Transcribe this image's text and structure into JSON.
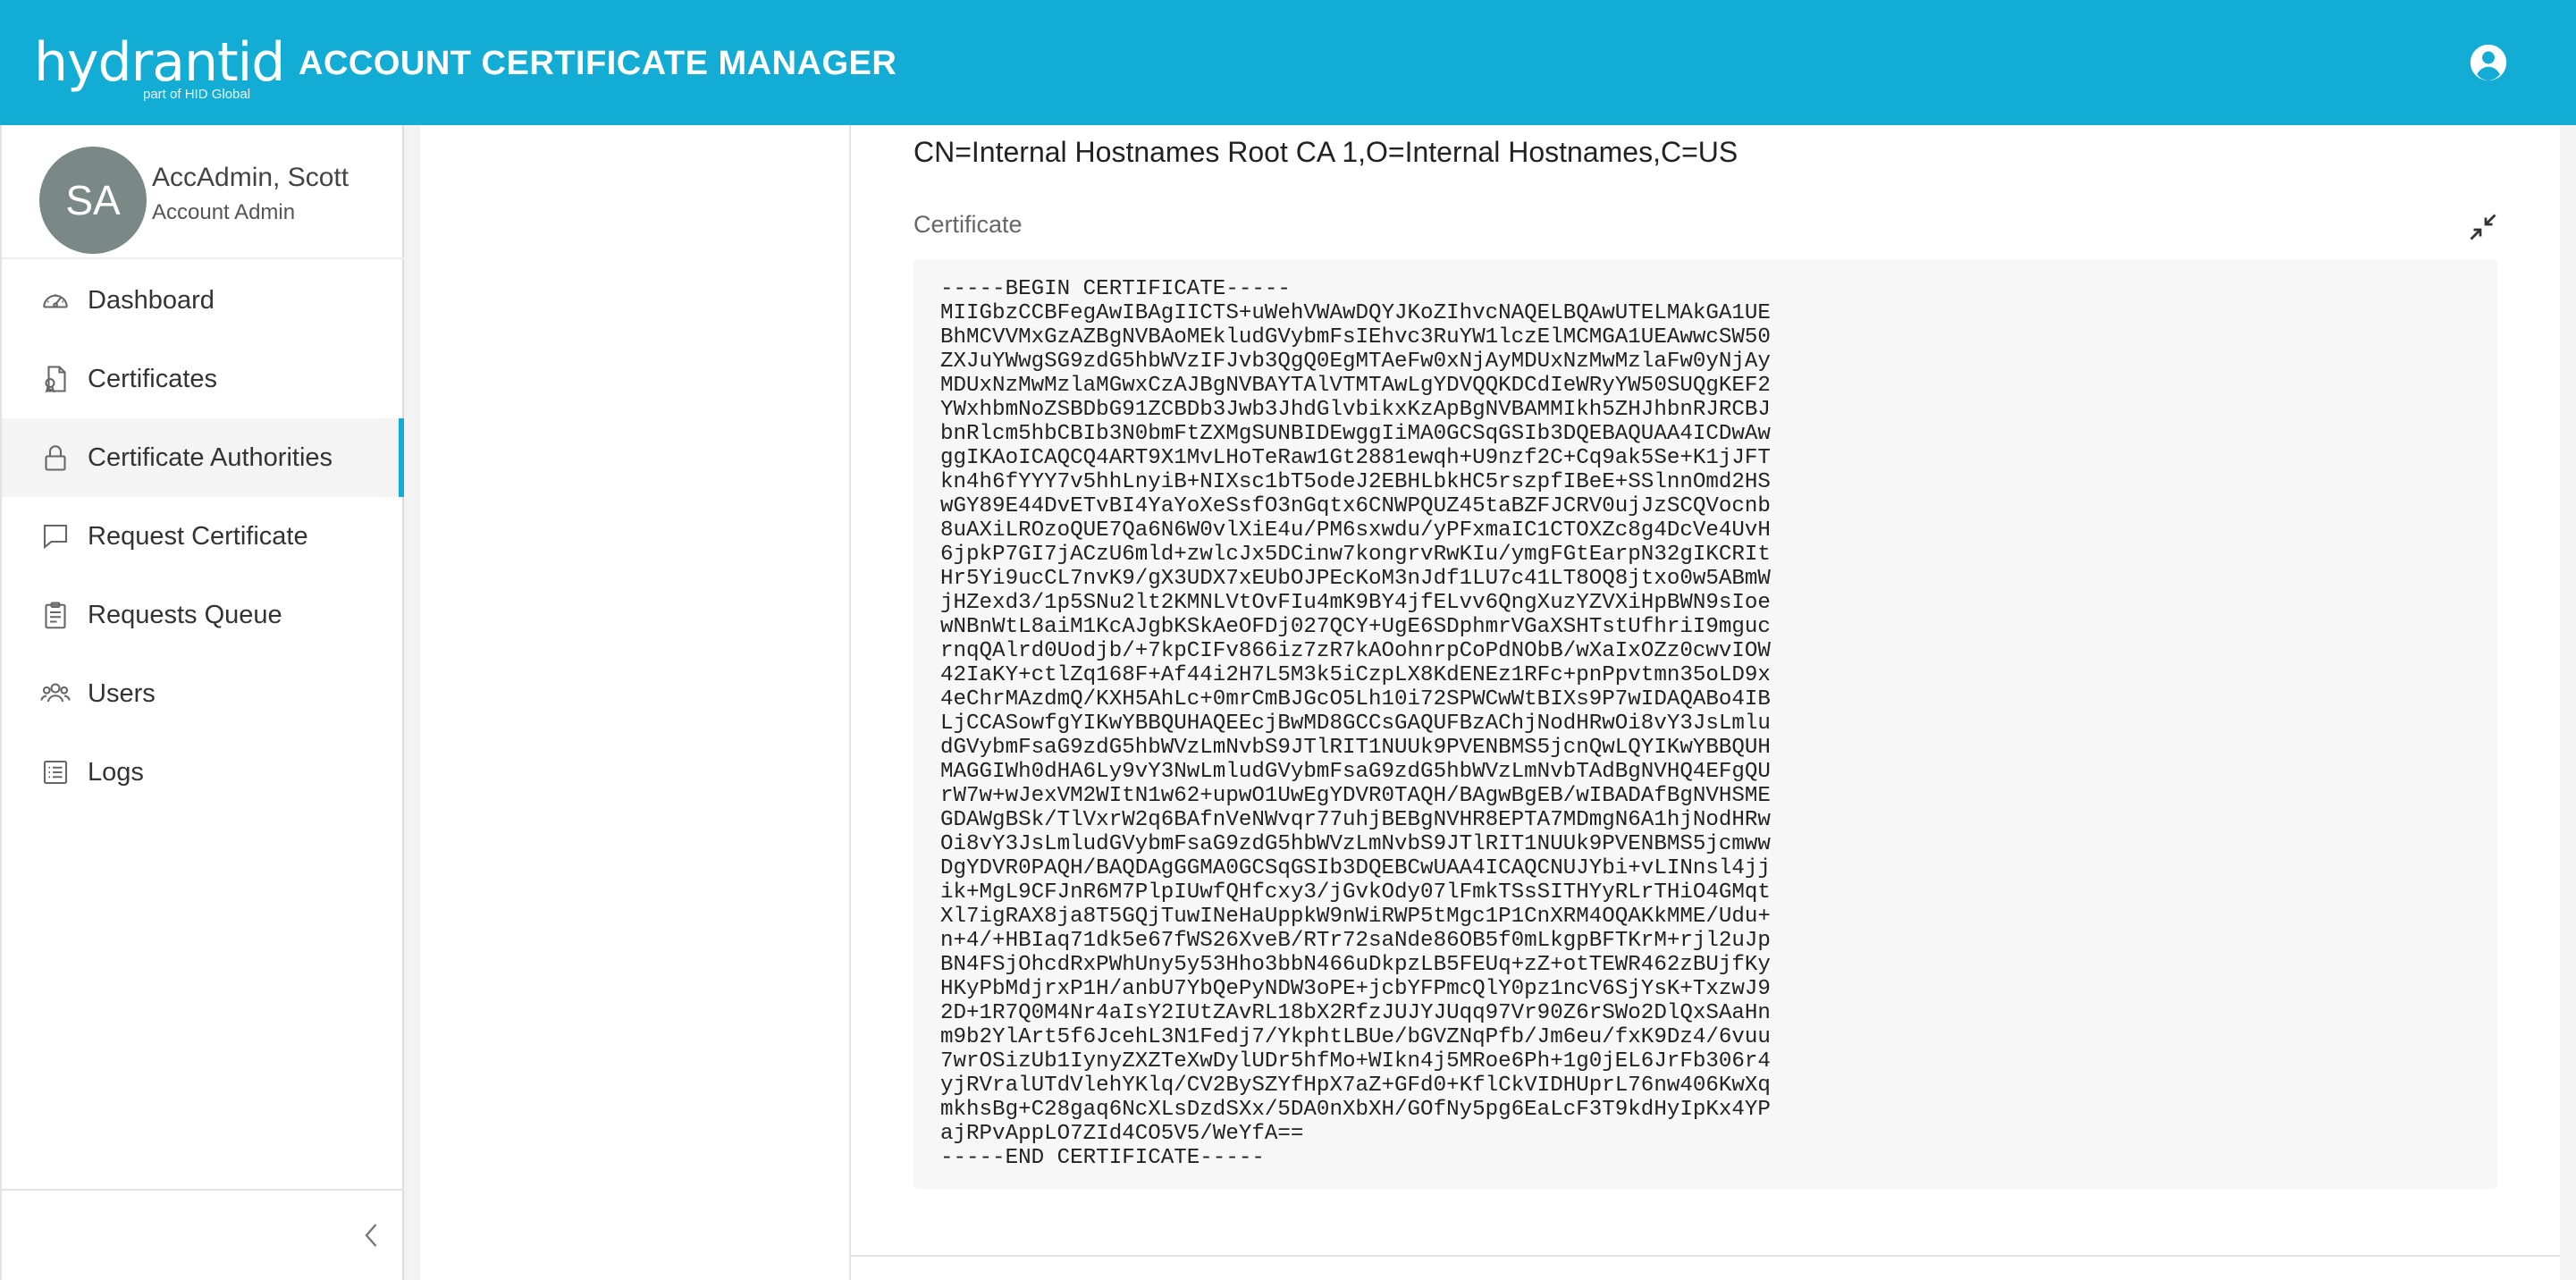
{
  "header": {
    "logo_text": "hydrantid",
    "logo_sub": "part of HID Global",
    "title": "ACCOUNT CERTIFICATE MANAGER",
    "account_icon": "account-circle-icon"
  },
  "sidebar": {
    "profile": {
      "initials": "SA",
      "name": "AccAdmin, Scott",
      "role": "Account Admin"
    },
    "items": [
      {
        "label": "Dashboard",
        "icon": "dashboard-gauge-icon",
        "active": false
      },
      {
        "label": "Certificates",
        "icon": "certificate-file-icon",
        "active": false
      },
      {
        "label": "Certificate Authorities",
        "icon": "lock-icon",
        "active": true
      },
      {
        "label": "Request Certificate",
        "icon": "chat-bubble-icon",
        "active": false
      },
      {
        "label": "Requests Queue",
        "icon": "clipboard-icon",
        "active": false
      },
      {
        "label": "Users",
        "icon": "users-icon",
        "active": false
      },
      {
        "label": "Logs",
        "icon": "list-icon",
        "active": false
      }
    ],
    "collapse_icon": "chevron-left-icon"
  },
  "main": {
    "issuer": "CN=Internal Hostnames Root CA 1,O=Internal Hostnames,C=US",
    "certificate_label": "Certificate",
    "collapse_icon": "collapse-arrows-icon",
    "certificate_pem": "-----BEGIN CERTIFICATE-----\nMIIGbzCCBFegAwIBAgIICTS+uWehVWAwDQYJKoZIhvcNAQELBQAwUTELMAkGA1UE\nBhMCVVMxGzAZBgNVBAoMEkludGVybmFsIEhvc3RuYW1lczElMCMGA1UEAwwcSW50\nZXJuYWwgSG9zdG5hbWVzIFJvb3QgQ0EgMTAeFw0xNjAyMDUxNzMwMzlaFw0yNjAy\nMDUxNzMwMzlaMGwxCzAJBgNVBAYTAlVTMTAwLgYDVQQKDCdIeWRyYW50SUQgKEF2\nYWxhbmNoZSBDbG91ZCBDb3Jwb3JhdGlvbikxKzApBgNVBAMMIkh5ZHJhbnRJRCBJ\nbnRlcm5hbCBIb3N0bmFtZXMgSUNBIDEwggIiMA0GCSqGSIb3DQEBAQUAA4ICDwAw\nggIKAoICAQCQ4ART9X1MvLHoTeRaw1Gt2881ewqh+U9nzf2C+Cq9ak5Se+K1jJFT\nkn4h6fYYY7v5hhLnyiB+NIXsc1bT5odeJ2EBHLbkHC5rszpfIBeE+SSlnnOmd2HS\nwGY89E44DvETvBI4YaYoXeSsfO3nGqtx6CNWPQUZ45taBZFJCRV0ujJzSCQVocnb\n8uAXiLROzoQUE7Qa6N6W0vlXiE4u/PM6sxwdu/yPFxmaIC1CTOXZc8g4DcVe4UvH\n6jpkP7GI7jACzU6mld+zwlcJx5DCinw7kongrvRwKIu/ymgFGtEarpN32gIKCRIt\nHr5Yi9ucCL7nvK9/gX3UDX7xEUbOJPEcKoM3nJdf1LU7c41LT8OQ8jtxo0w5ABmW\njHZexd3/1p5SNu2lt2KMNLVtOvFIu4mK9BY4jfELvv6QngXuzYZVXiHpBWN9sIoe\nwNBnWtL8aiM1KcAJgbKSkAeOFDj027QCY+UgE6SDphmrVGaXSHTstUfhriI9mguc\nrnqQAlrd0Uodjb/+7kpCIFv866iz7zR7kAOohnrpCoPdNObB/wXaIxOZz0cwvIOW\n42IaKY+ctlZq168F+Af44i2H7L5M3k5iCzpLX8KdENEz1RFc+pnPpvtmn35oLD9x\n4eChrMAzdmQ/KXH5AhLc+0mrCmBJGcO5Lh10i72SPWCwWtBIXs9P7wIDAQABo4IB\nLjCCASowfgYIKwYBBQUHAQEEcjBwMD8GCCsGAQUFBzAChjNodHRwOi8vY3JsLmlu\ndGVybmFsaG9zdG5hbWVzLmNvbS9JTlRIT1NUUk9PVENBMS5jcnQwLQYIKwYBBQUH\nMAGGIWh0dHA6Ly9vY3NwLmludGVybmFsaG9zdG5hbWVzLmNvbTAdBgNVHQ4EFgQU\nrW7w+wJexVM2WItN1w62+upwO1UwEgYDVR0TAQH/BAgwBgEB/wIBADAfBgNVHSME\nGDAWgBSk/TlVxrW2q6BAfnVeNWvqr77uhjBEBgNVHR8EPTA7MDmgN6A1hjNodHRw\nOi8vY3JsLmludGVybmFsaG9zdG5hbWVzLmNvbS9JTlRIT1NUUk9PVENBMS5jcmww\nDgYDVR0PAQH/BAQDAgGGMA0GCSqGSIb3DQEBCwUAA4ICAQCNUJYbi+vLINnsl4jj\nik+MgL9CFJnR6M7PlpIUwfQHfcxy3/jGvkOdy07lFmkTSsSITHYyRLrTHiO4GMqt\nXl7igRAX8ja8T5GQjTuwINeHaUppkW9nWiRWP5tMgc1P1CnXRM4OQAKkMME/Udu+\nn+4/+HBIaq71dk5e67fWS26XveB/RTr72saNde86OB5f0mLkgpBFTKrM+rjl2uJp\nBN4FSjOhcdRxPWhUny5y53Hho3bbN466uDkpzLB5FEUq+zZ+otTEWR462zBUjfKy\nHKyPbMdjrxP1H/anbU7YbQePyNDW3oPE+jcbYFPmcQlY0pz1ncV6SjYsK+TxzwJ9\n2D+1R7Q0M4Nr4aIsY2IUtZAvRL18bX2RfzJUJYJUqq97Vr90Z6rSWo2DlQxSAaHn\nm9b2YlArt5f6JcehL3N1Fedj7/YkphtLBUe/bGVZNqPfb/Jm6eu/fxK9Dz4/6vuu\n7wrOSizUb1IynyZXZTeXwDylUDr5hfMo+WIkn4j5MRoe6Ph+1g0jEL6JrFb306r4\nyjRVralUTdVlehYKlq/CV2BySZYfHpX7aZ+GFd0+KflCkVIDHUprL76nw406KwXq\nmkhsBg+C28gaq6NcXLsDzdSXx/5DA0nXbXH/GOfNy5pg6EaLcF3T9kdHyIpKx4YP\najRPvAppLO7ZId4CO5V5/WeYfA==\n-----END CERTIFICATE-----"
  }
}
